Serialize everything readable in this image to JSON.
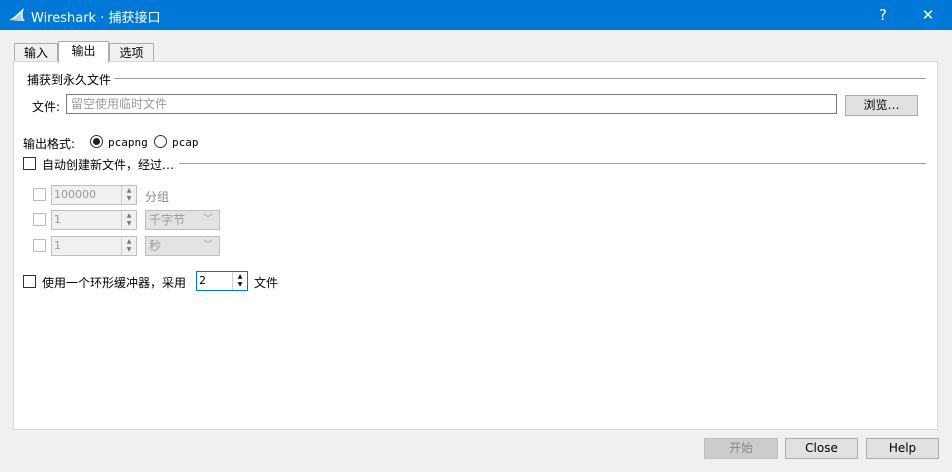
{
  "window": {
    "title": "Wireshark · 捕获接口",
    "help_glyph": "?",
    "close_glyph": "✕",
    "icon": "wireshark-fin-icon"
  },
  "tabs": [
    {
      "label": "输入",
      "active": false
    },
    {
      "label": "输出",
      "active": true
    },
    {
      "label": "选项",
      "active": false
    }
  ],
  "capture_file": {
    "section_title": "捕获到永久文件",
    "file_label": "文件:",
    "file_placeholder": "留空使用临时文件",
    "browse_label": "浏览…"
  },
  "output_format": {
    "label": "输出格式:",
    "options": [
      {
        "label": "pcapng",
        "selected": true
      },
      {
        "label": "pcap",
        "selected": false
      }
    ]
  },
  "auto_new_file": {
    "label": "自动创建新文件，经过…",
    "checked": false,
    "rows": [
      {
        "value": "100000",
        "unit": "分组",
        "unit_kind": "label"
      },
      {
        "value": "1",
        "unit": "千字节",
        "unit_kind": "combo"
      },
      {
        "value": "1",
        "unit": "秒",
        "unit_kind": "combo"
      }
    ]
  },
  "ring_buffer": {
    "label": "使用一个环形缓冲器，采用",
    "value": "2",
    "suffix": "文件",
    "checked": false
  },
  "footer": {
    "start_label": "开始",
    "close_label": "Close",
    "help_label": "Help"
  }
}
